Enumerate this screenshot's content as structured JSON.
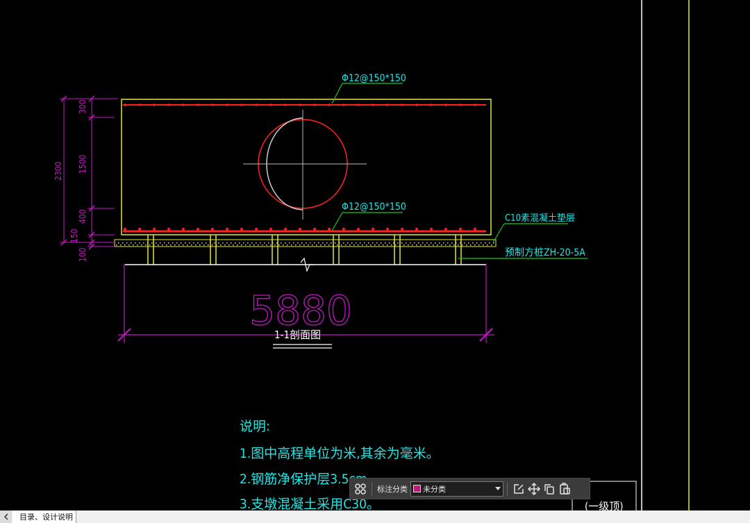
{
  "drawing": {
    "rebar_top_label": "Φ12@150*150",
    "rebar_bottom_label": "Φ12@150*150",
    "cushion_label": "C10素混凝土垫层",
    "pile_label": "预制方桩ZH-20-5A",
    "overall_dim": "5880",
    "section_title": "1-1剖面图",
    "dims": [
      "300",
      "1500",
      "400",
      "150",
      "100",
      "2300"
    ],
    "title_block_text": "(一级顶)"
  },
  "notes": {
    "heading": "说明:",
    "lines": [
      "1.图中高程单位为米,其余为毫米。",
      "2.钢筋净保护层3.5cm。",
      "3.支墩混凝土采用C30。"
    ]
  },
  "toolbar": {
    "category_label": "标注分类",
    "selected_value": "未分类",
    "swatch_color": "#c2187a"
  },
  "tabs": [
    {
      "label": "目录、设计说明"
    }
  ],
  "colors": {
    "background": "#000000",
    "outline": "#e6e63c",
    "rebar": "#ff2020",
    "dimension": "#c318c3",
    "leader": "#18c818",
    "label": "#22e6e6"
  }
}
